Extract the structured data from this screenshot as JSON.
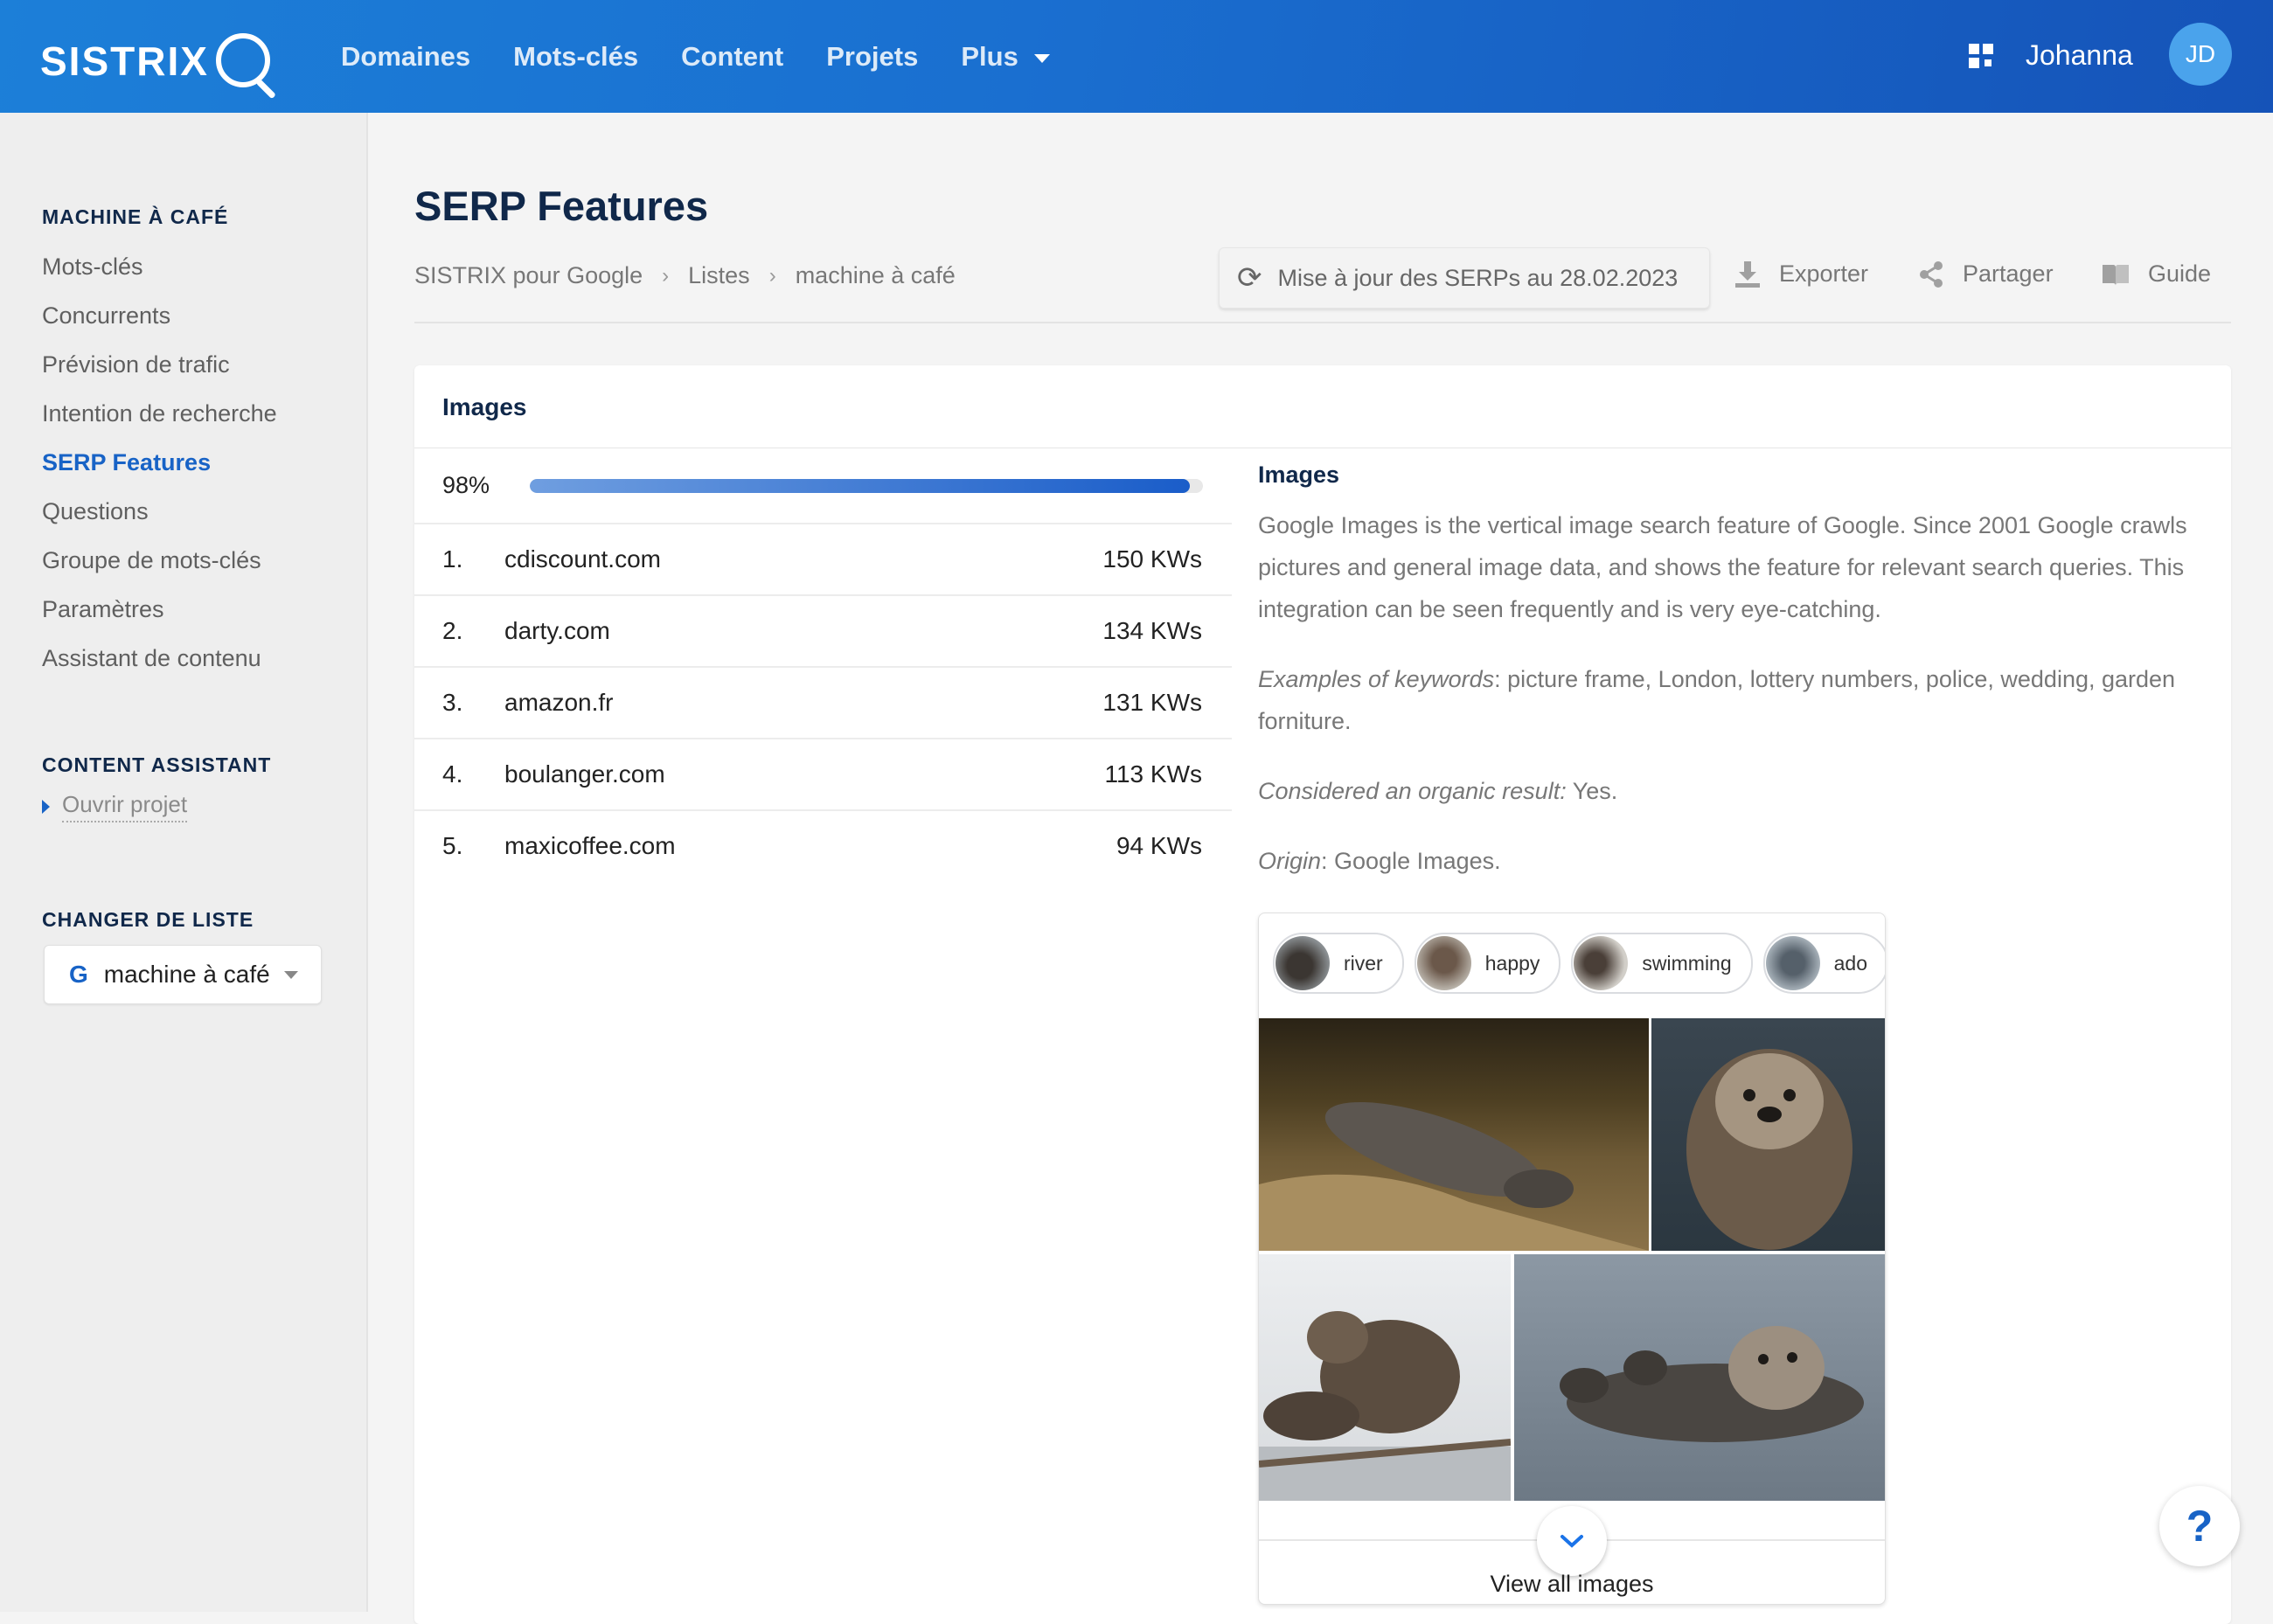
{
  "header": {
    "logo": "SISTRIX",
    "nav": [
      "Domaines",
      "Mots-clés",
      "Content",
      "Projets",
      "Plus"
    ],
    "user_name": "Johanna",
    "user_initials": "JD"
  },
  "sidebar": {
    "section1_title": "MACHINE À CAFÉ",
    "items": [
      {
        "label": "Mots-clés"
      },
      {
        "label": "Concurrents"
      },
      {
        "label": "Prévision de trafic"
      },
      {
        "label": "Intention de recherche"
      },
      {
        "label": "SERP Features",
        "active": true
      },
      {
        "label": "Questions"
      },
      {
        "label": "Groupe de mots-clés"
      },
      {
        "label": "Paramètres"
      },
      {
        "label": "Assistant de contenu"
      }
    ],
    "section2_title": "CONTENT ASSISTANT",
    "open_project": "Ouvrir projet",
    "section3_title": "CHANGER DE LISTE",
    "list_icon": "G",
    "list_value": "machine à café"
  },
  "page": {
    "title": "SERP Features",
    "breadcrumb": [
      "SISTRIX pour Google",
      "Listes",
      "machine à café"
    ],
    "update_label": "Mise à jour des SERPs au 28.02.2023",
    "export_label": "Exporter",
    "share_label": "Partager",
    "guide_label": "Guide"
  },
  "card": {
    "title": "Images",
    "percent_label": "98%",
    "percent_value": 0.98,
    "domains": [
      {
        "rank": "1.",
        "domain": "cdiscount.com",
        "kws": "150 KWs"
      },
      {
        "rank": "2.",
        "domain": "darty.com",
        "kws": "134 KWs"
      },
      {
        "rank": "3.",
        "domain": "amazon.fr",
        "kws": "131 KWs"
      },
      {
        "rank": "4.",
        "domain": "boulanger.com",
        "kws": "113 KWs"
      },
      {
        "rank": "5.",
        "domain": "maxicoffee.com",
        "kws": "94 KWs"
      }
    ],
    "desc_title": "Images",
    "desc_text": "Google Images is the vertical image search feature of Google. Since 2001 Google crawls pictures and general image data, and shows the feature for relevant search queries. This integration can be seen frequently and is very eye-catching.",
    "examples_label": "Examples of keywords",
    "examples_text": ": picture frame, London, lottery numbers, police, wedding, garden forniture.",
    "organic_label": "Considered an organic result:",
    "organic_text": " Yes.",
    "origin_label": "Origin",
    "origin_text": ": Google Images.",
    "preview": {
      "chips": [
        "river",
        "happy",
        "swimming",
        "ado"
      ],
      "view_all": "View all images"
    }
  },
  "help_label": "?"
}
